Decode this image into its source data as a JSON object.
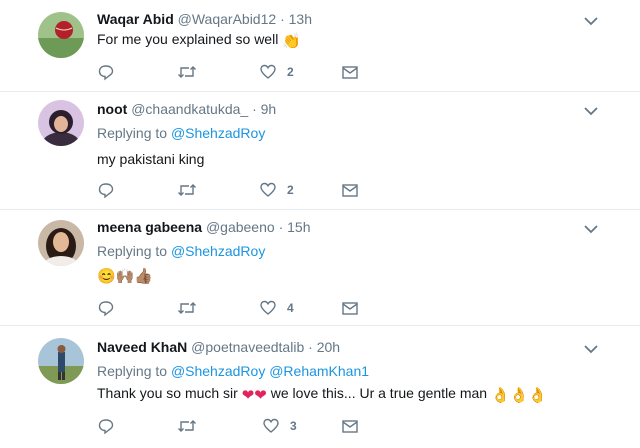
{
  "tweets": [
    {
      "name": "Waqar Abid",
      "handle": "@WaqarAbid12",
      "dot": "·",
      "time": "13h",
      "replying_label": "",
      "mentions": "",
      "text": "For me you explained so well",
      "emoji": "👏",
      "likes": "2",
      "avatar": "cricket-ball-avatar"
    },
    {
      "name": "noot",
      "handle": "@chaandkatukda_",
      "dot": "·",
      "time": "9h",
      "replying_label": "Replying to",
      "mentions": "@ShehzadRoy",
      "text": "my pakistani king",
      "emoji": "",
      "likes": "2",
      "avatar": "woman-hijab-avatar"
    },
    {
      "name": "meena gabeena",
      "handle": "@gabeeno",
      "dot": "·",
      "time": "15h",
      "replying_label": "Replying to",
      "mentions": "@ShehzadRoy",
      "text": "",
      "emoji": "😊🙌🏽👍🏽",
      "likes": "4",
      "avatar": "woman-portrait-avatar"
    },
    {
      "name": "Naveed KhaN",
      "handle": "@poetnaveedtalib",
      "dot": "·",
      "time": "20h",
      "replying_label": "Replying to",
      "mentions": "@ShehzadRoy @RehamKhan1",
      "text": "Thank you so much sir",
      "text_hearts": "❤❤",
      "text_after": "we love this... Ur a true gentle man",
      "emoji": "👌👌👌",
      "likes": "3",
      "avatar": "man-outdoor-avatar"
    }
  ],
  "icons": {
    "reply": "reply-icon",
    "retweet": "retweet-icon",
    "like": "heart-icon",
    "dm": "envelope-icon",
    "menu": "chevron-down-icon"
  },
  "colors": {
    "name": "#14171a",
    "meta": "#657786",
    "mention": "#1b95e0",
    "divider": "#e6ecf0",
    "heart": "#e0245e"
  }
}
